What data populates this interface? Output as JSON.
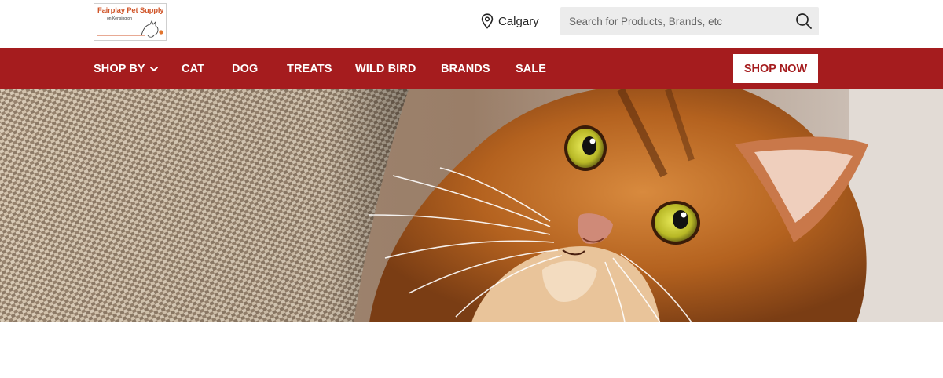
{
  "header": {
    "logo": {
      "title": "Fairplay Pet Supply",
      "subtitle": "on Kensington"
    },
    "location": {
      "icon": "map-pin-icon",
      "label": "Calgary"
    },
    "search": {
      "placeholder": "Search for Products, Brands, etc",
      "value": "",
      "icon": "search-icon"
    }
  },
  "nav": {
    "items": [
      {
        "label": "SHOP BY",
        "has_dropdown": true
      },
      {
        "label": "CAT"
      },
      {
        "label": "DOG"
      },
      {
        "label": "TREATS"
      },
      {
        "label": "WILD BIRD"
      },
      {
        "label": "BRANDS"
      },
      {
        "label": "SALE"
      }
    ],
    "cta_label": "SHOP NOW"
  },
  "colors": {
    "brand_red": "#a51c1e",
    "logo_orange": "#d0562a",
    "search_bg": "#ececec"
  },
  "hero": {
    "image": "cat-looking-up-beside-scratching-post"
  }
}
